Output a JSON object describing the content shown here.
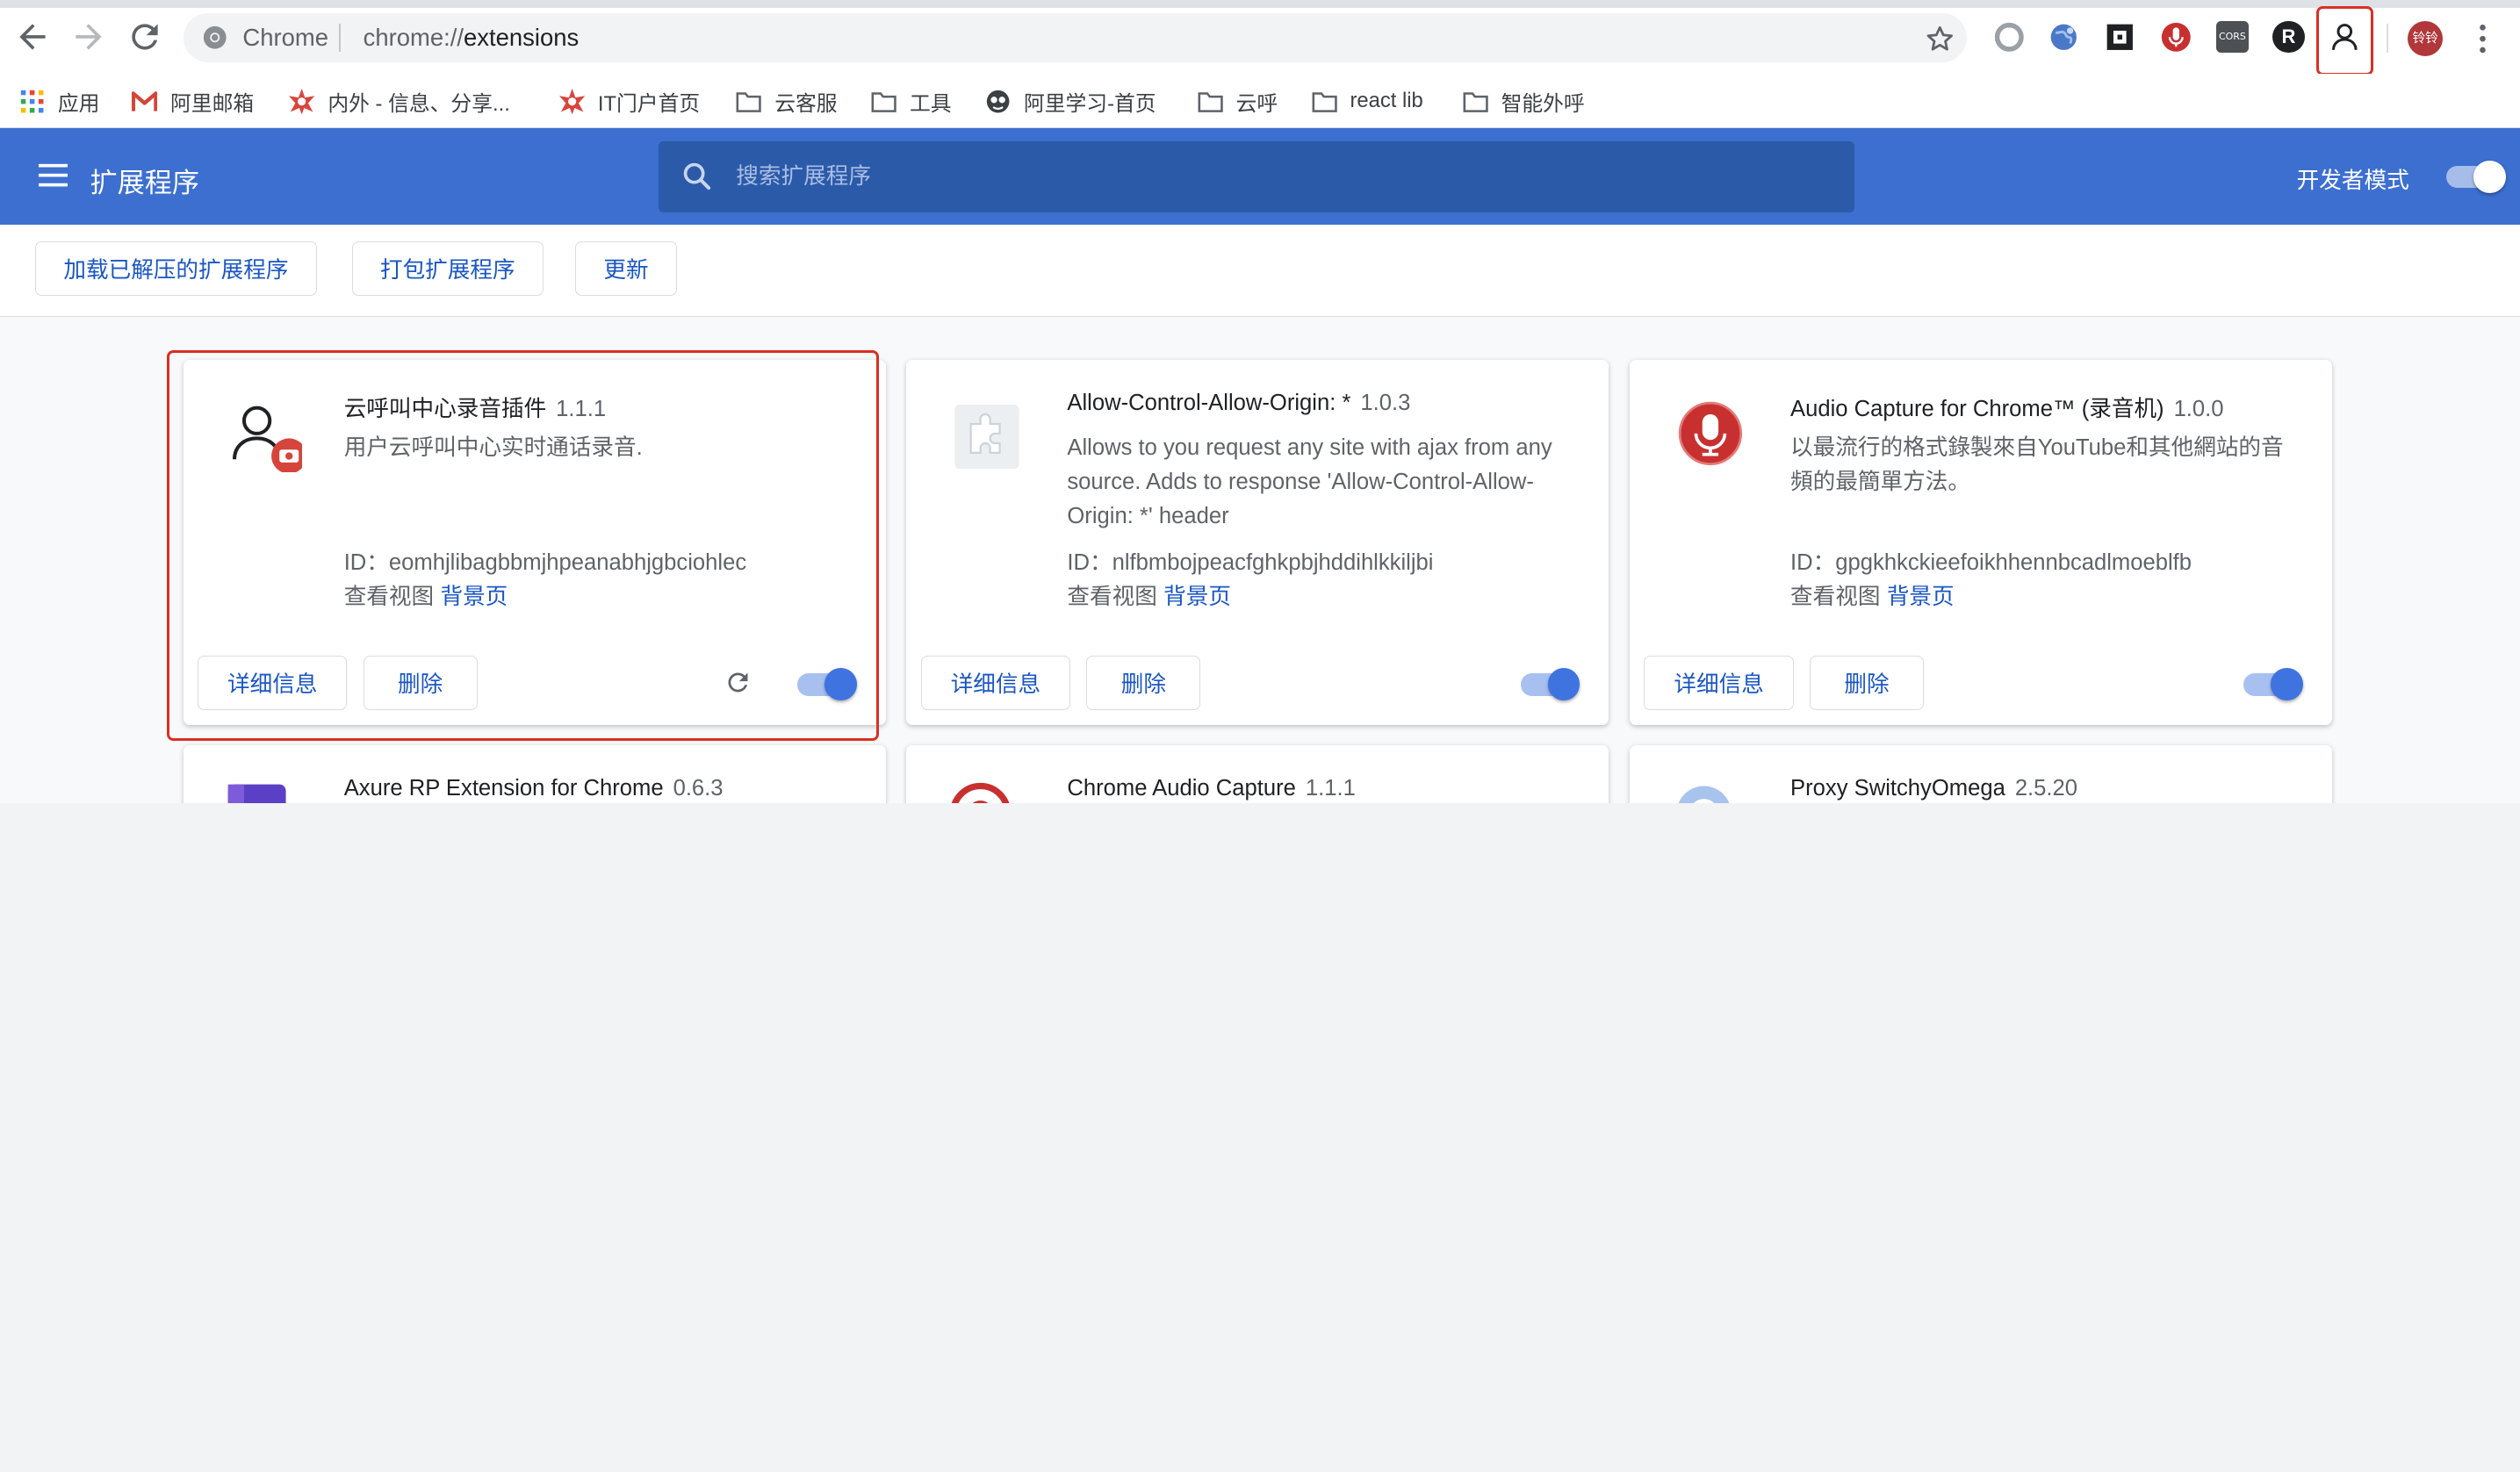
{
  "browser": {
    "site_label": "Chrome",
    "url_scheme": "chrome://",
    "url_path": "extensions",
    "profile_initials": "铃铃",
    "toolbar_icons": [
      "back-arrow-icon",
      "forward-arrow-icon",
      "reload-icon",
      "star-icon",
      "circle-extension-icon",
      "globe-extension-icon",
      "square-extension-icon",
      "mic-extension-icon",
      "cors-extension-icon",
      "r-extension-icon",
      "person-extension-icon",
      "more-menu-icon"
    ],
    "cors_badge": "CORS",
    "r_badge": "R"
  },
  "bookmarks": [
    {
      "label": "应用",
      "icon": "apps-grid-icon"
    },
    {
      "label": "阿里邮箱",
      "icon": "mail-icon"
    },
    {
      "label": "内外 - 信息、分享...",
      "icon": "star-logo-icon"
    },
    {
      "label": "IT门户首页",
      "icon": "star-logo-icon"
    },
    {
      "label": "云客服",
      "icon": "folder-icon"
    },
    {
      "label": "工具",
      "icon": "folder-icon"
    },
    {
      "label": "阿里学习-首页",
      "icon": "mascot-icon"
    },
    {
      "label": "云呼",
      "icon": "folder-icon"
    },
    {
      "label": "react lib",
      "icon": "folder-icon"
    },
    {
      "label": "智能外呼",
      "icon": "folder-icon"
    }
  ],
  "header": {
    "title": "扩展程序",
    "search_placeholder": "搜索扩展程序",
    "dev_mode_label": "开发者模式",
    "dev_mode_on": true,
    "color": "#3c6fd0"
  },
  "actions": {
    "load_unpacked": "加载已解压的扩展程序",
    "pack": "打包扩展程序",
    "update": "更新"
  },
  "card_labels": {
    "details": "详细信息",
    "remove": "删除",
    "id_prefix": "ID：",
    "views_prefix": "查看视图",
    "background_page": "背景页"
  },
  "extensions": [
    {
      "name": "云呼叫中心录音插件",
      "version": "1.1.1",
      "description": "用户云呼叫中心实时通话录音.",
      "id": "eomhjlibagbbmjhpeanabhjgbciohlec",
      "icon": "person-recording-icon",
      "enabled": true
    },
    {
      "name": "Allow-Control-Allow-Origin: *",
      "version": "1.0.3",
      "description": "Allows to you request any site with ajax from any source. Adds to response 'Allow-Control-Allow-Origin: *' header",
      "id": "nlfbmbojpeacfghkpbjhddihlkkiljbi",
      "icon": "puzzle-piece-icon",
      "enabled": true
    },
    {
      "name": "Audio Capture for Chrome™ (录音机)",
      "version": "1.0.0",
      "description": "以最流行的格式錄製來自YouTube和其他網站的音頻的最簡單方法。",
      "id": "gpgkhkckieefoikhhennbcadlmoeblfb",
      "icon": "red-microphone-icon",
      "enabled": true
    },
    {
      "name": "Axure RP Extension for Chrome",
      "version": "0.6.3",
      "icon": "axure-icon"
    },
    {
      "name": "Chrome Audio Capture",
      "version": "1.1.1",
      "icon": "red-record-icon"
    },
    {
      "name": "Proxy SwitchyOmega",
      "version": "2.5.20",
      "icon": "blue-circle-icon"
    }
  ]
}
